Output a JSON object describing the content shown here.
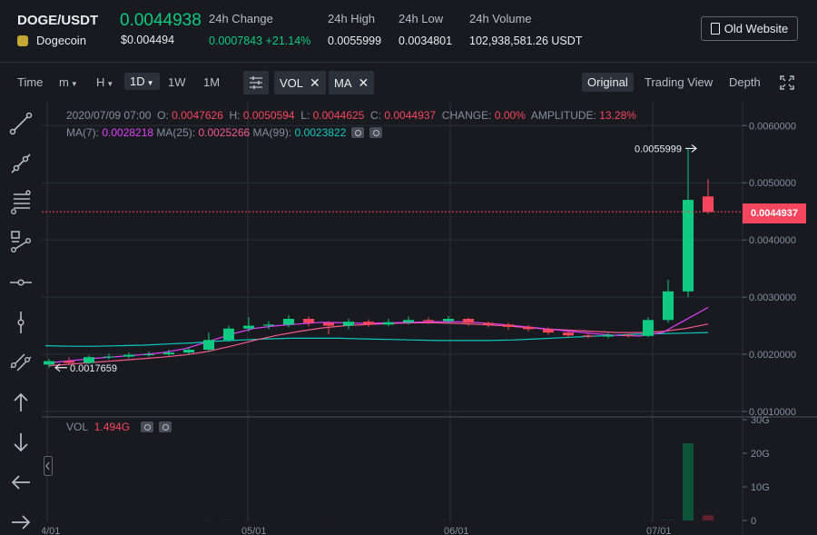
{
  "header": {
    "symbol": "DOGE/USDT",
    "coin_name": "Dogecoin",
    "last_price": "0.0044938",
    "last_price_usd": "$0.004494",
    "stats": [
      {
        "label": "24h Change",
        "value": "0.0007843 +21.14%"
      },
      {
        "label": "24h High",
        "value": "0.0055999"
      },
      {
        "label": "24h Low",
        "value": "0.0034801"
      },
      {
        "label": "24h Volume",
        "value": "102,938,581.26 USDT"
      }
    ],
    "old_website_label": "Old Website"
  },
  "toolbar": {
    "time_label": "Time",
    "minute_label": "m",
    "hour_label": "H",
    "day_label": "1D",
    "week_label": "1W",
    "month_label": "1M",
    "vol_chip": "VOL",
    "ma_chip": "MA",
    "view_tabs": [
      "Original",
      "Trading View",
      "Depth"
    ]
  },
  "legend": {
    "date": "2020/07/09 07:00",
    "open_label": "O:",
    "open": "0.0047626",
    "high_label": "H:",
    "high": "0.0050594",
    "low_label": "L:",
    "low": "0.0044625",
    "close_label": "C:",
    "close": "0.0044937",
    "change_label": "CHANGE:",
    "change": "0.00%",
    "amplitude_label": "AMPLITUDE:",
    "amplitude": "13.28%",
    "ma7_label": "MA(7):",
    "ma7": "0.0028218",
    "ma25_label": "MA(25):",
    "ma25": "0.0025266",
    "ma99_label": "MA(99):",
    "ma99": "0.0023822",
    "vol_label": "VOL",
    "vol": "1.494G"
  },
  "chart": {
    "price_ticks": [
      "0.0060000",
      "0.0050000",
      "0.0040000",
      "0.0030000",
      "0.0020000",
      "0.0010000"
    ],
    "vol_ticks": [
      "30G",
      "20G",
      "10G",
      "0"
    ],
    "date_ticks": [
      "4/01",
      "05/01",
      "06/01",
      "07/01"
    ],
    "current_price_tag": "0.0044937",
    "high_marker": "0.0055999",
    "low_marker": "0.0017659",
    "colors": {
      "up": "#0ecb81",
      "down": "#f6465d",
      "ma7": "#e040fb",
      "ma25": "#f55a8a",
      "ma99": "#0fc9c0"
    }
  },
  "chart_data": {
    "type": "candlestick",
    "price_axis": {
      "ylim": [
        0.0009,
        0.0065
      ],
      "ticks": [
        0.006,
        0.005,
        0.004,
        0.003,
        0.002,
        0.001
      ]
    },
    "volume_axis": {
      "ylim": [
        0,
        30
      ],
      "unit": "G",
      "ticks": [
        30,
        20,
        10,
        0
      ]
    },
    "x_ticks": [
      "4/01",
      "05/01",
      "06/01",
      "07/01"
    ],
    "highlight": {
      "high": 0.0055999,
      "low": 0.0017659,
      "last": 0.0044937
    },
    "candles_sampled": [
      {
        "o": 0.00182,
        "c": 0.00188,
        "h": 0.00192,
        "l": 0.00176
      },
      {
        "o": 0.00188,
        "c": 0.00185,
        "h": 0.00195,
        "l": 0.00181
      },
      {
        "o": 0.00185,
        "c": 0.00195,
        "h": 0.00198,
        "l": 0.00183
      },
      {
        "o": 0.00195,
        "c": 0.00196,
        "h": 0.00201,
        "l": 0.00191
      },
      {
        "o": 0.00196,
        "c": 0.00199,
        "h": 0.00203,
        "l": 0.00193
      },
      {
        "o": 0.00199,
        "c": 0.002,
        "h": 0.00205,
        "l": 0.00196
      },
      {
        "o": 0.002,
        "c": 0.00203,
        "h": 0.00208,
        "l": 0.00197
      },
      {
        "o": 0.00203,
        "c": 0.00208,
        "h": 0.00212,
        "l": 0.00199
      },
      {
        "o": 0.00208,
        "c": 0.00225,
        "h": 0.00238,
        "l": 0.00205
      },
      {
        "o": 0.00225,
        "c": 0.00245,
        "h": 0.0025,
        "l": 0.00222
      },
      {
        "o": 0.00245,
        "c": 0.0025,
        "h": 0.00265,
        "l": 0.0024
      },
      {
        "o": 0.0025,
        "c": 0.00252,
        "h": 0.00258,
        "l": 0.00244
      },
      {
        "o": 0.00252,
        "c": 0.00262,
        "h": 0.00268,
        "l": 0.00247
      },
      {
        "o": 0.00262,
        "c": 0.00255,
        "h": 0.00266,
        "l": 0.00249
      },
      {
        "o": 0.00255,
        "c": 0.0025,
        "h": 0.00258,
        "l": 0.00235
      },
      {
        "o": 0.0025,
        "c": 0.00257,
        "h": 0.00262,
        "l": 0.00244
      },
      {
        "o": 0.00257,
        "c": 0.00252,
        "h": 0.00261,
        "l": 0.00248
      },
      {
        "o": 0.00252,
        "c": 0.00256,
        "h": 0.00262,
        "l": 0.00249
      },
      {
        "o": 0.00256,
        "c": 0.0026,
        "h": 0.00266,
        "l": 0.00252
      },
      {
        "o": 0.0026,
        "c": 0.00258,
        "h": 0.00264,
        "l": 0.00253
      },
      {
        "o": 0.00258,
        "c": 0.00262,
        "h": 0.00267,
        "l": 0.00254
      },
      {
        "o": 0.00262,
        "c": 0.00255,
        "h": 0.00264,
        "l": 0.0025
      },
      {
        "o": 0.00255,
        "c": 0.00252,
        "h": 0.00257,
        "l": 0.00247
      },
      {
        "o": 0.00252,
        "c": 0.00248,
        "h": 0.00255,
        "l": 0.00243
      },
      {
        "o": 0.00248,
        "c": 0.00244,
        "h": 0.00251,
        "l": 0.0024
      },
      {
        "o": 0.00244,
        "c": 0.00238,
        "h": 0.00247,
        "l": 0.00234
      },
      {
        "o": 0.00238,
        "c": 0.00233,
        "h": 0.0024,
        "l": 0.00229
      },
      {
        "o": 0.00233,
        "c": 0.00231,
        "h": 0.00236,
        "l": 0.00228
      },
      {
        "o": 0.00231,
        "c": 0.00234,
        "h": 0.00237,
        "l": 0.00228
      },
      {
        "o": 0.00234,
        "c": 0.00232,
        "h": 0.00236,
        "l": 0.00229
      },
      {
        "o": 0.00232,
        "c": 0.0026,
        "h": 0.00265,
        "l": 0.0023
      },
      {
        "o": 0.0026,
        "c": 0.0031,
        "h": 0.0033,
        "l": 0.00255
      },
      {
        "o": 0.0031,
        "c": 0.0047,
        "h": 0.0056,
        "l": 0.003
      },
      {
        "o": 0.00476,
        "c": 0.00449,
        "h": 0.00506,
        "l": 0.00446
      }
    ],
    "ma7_sampled": [
      0.00185,
      0.00189,
      0.00193,
      0.00196,
      0.00199,
      0.00203,
      0.0021,
      0.00222,
      0.00235,
      0.00245,
      0.0025,
      0.00253,
      0.00256,
      0.00255,
      0.00254,
      0.00255,
      0.00256,
      0.00257,
      0.00257,
      0.00255,
      0.00252,
      0.00248,
      0.00244,
      0.0024,
      0.00236,
      0.00233,
      0.00232,
      0.00238,
      0.0026,
      0.00282
    ],
    "ma25_sampled": [
      0.0018,
      0.00183,
      0.00186,
      0.00189,
      0.00192,
      0.00195,
      0.00199,
      0.00205,
      0.00214,
      0.00224,
      0.00233,
      0.0024,
      0.00246,
      0.0025,
      0.00252,
      0.00254,
      0.00255,
      0.00255,
      0.00254,
      0.00252,
      0.0025,
      0.00247,
      0.00244,
      0.00242,
      0.0024,
      0.00238,
      0.00238,
      0.0024,
      0.00245,
      0.00253
    ],
    "ma99_sampled": [
      0.00215,
      0.00214,
      0.00214,
      0.00215,
      0.00216,
      0.00218,
      0.0022,
      0.00223,
      0.00225,
      0.00227,
      0.00228,
      0.00228,
      0.00228,
      0.00227,
      0.00226,
      0.00225,
      0.00224,
      0.00224,
      0.00224,
      0.00225,
      0.00227,
      0.00229,
      0.00231,
      0.00233,
      0.00235,
      0.00236,
      0.00237,
      0.00238
    ]
  }
}
